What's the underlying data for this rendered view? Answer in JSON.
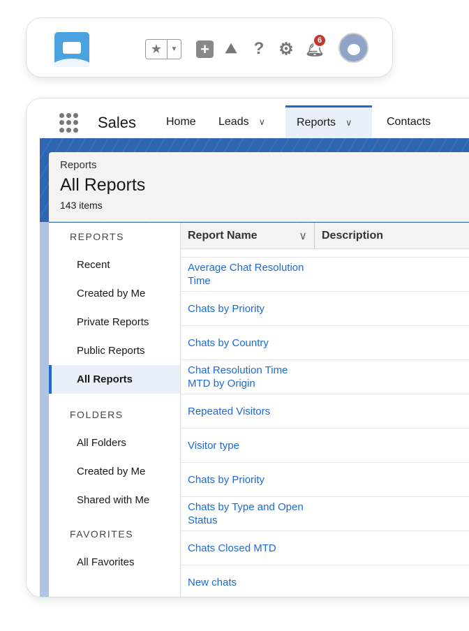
{
  "header": {
    "notification_count": "6",
    "icons": [
      "app-logo",
      "favorites-star-icon",
      "favorites-dropdown-icon",
      "add-icon",
      "trailhead-icon",
      "help-icon",
      "setup-gear-icon",
      "bell-icon",
      "avatar"
    ]
  },
  "nav": {
    "app_name": "Sales",
    "tabs": [
      {
        "label": "Home"
      },
      {
        "label": "Leads"
      },
      {
        "label": "Reports"
      },
      {
        "label": "Contacts"
      }
    ]
  },
  "page": {
    "breadcrumb": "Reports",
    "title": "All Reports",
    "count": "143 items"
  },
  "sidebar": {
    "sections": [
      {
        "title": "REPORTS",
        "items": [
          "Recent",
          "Created by Me",
          "Private Reports",
          "Public Reports",
          "All Reports"
        ]
      },
      {
        "title": "FOLDERS",
        "items": [
          "All Folders",
          "Created by Me",
          "Shared with Me"
        ]
      },
      {
        "title": "FAVORITES",
        "items": [
          "All Favorites"
        ]
      }
    ],
    "selected": "All Reports"
  },
  "table": {
    "columns": [
      "Report Name",
      "Description"
    ],
    "rows": [
      "Average Chat Resolution Time",
      "Chats by Priority",
      "Chats by Country",
      "Chat Resolution Time MTD by Origin",
      "Repeated Visitors",
      "Visitor type",
      "Chats by Priority",
      "Chats by Type and Open Status",
      "Chats Closed MTD",
      "New chats"
    ]
  },
  "colors": {
    "accent": "#1b6ad7",
    "banner": "#2f66b2",
    "badge": "#c23934"
  }
}
